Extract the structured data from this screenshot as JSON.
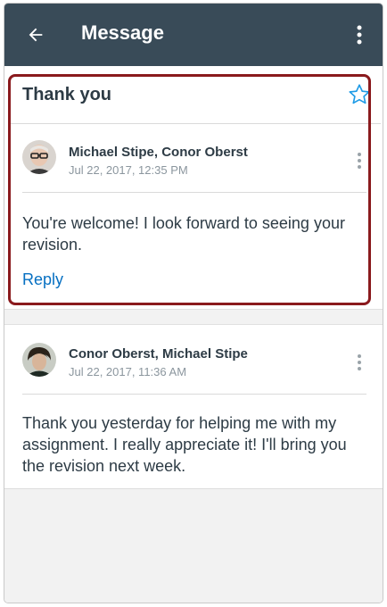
{
  "appbar": {
    "title": "Message",
    "back_icon": "arrow-left-icon",
    "menu_icon": "more-vertical-icon"
  },
  "conversation": {
    "subject": "Thank you",
    "starred": false,
    "star_icon": "star-outline-icon",
    "highlight_color": "#8a1a1d",
    "messages": [
      {
        "participants": "Michael Stipe, Conor Oberst",
        "date": "Jul 22, 2017, 12:35 PM",
        "body": "You're welcome! I look forward to seeing your revision.",
        "reply_label": "Reply"
      },
      {
        "participants": "Conor Oberst, Michael Stipe",
        "date": "Jul 22, 2017, 11:36 AM",
        "body": "Thank you yesterday for helping me with my assignment. I really appreciate it! I'll bring you the revision next week."
      }
    ]
  },
  "colors": {
    "appbar": "#394b58",
    "link": "#0770c2",
    "star": "#1e9be6",
    "text": "#2d3b45",
    "muted": "#8b969e"
  }
}
